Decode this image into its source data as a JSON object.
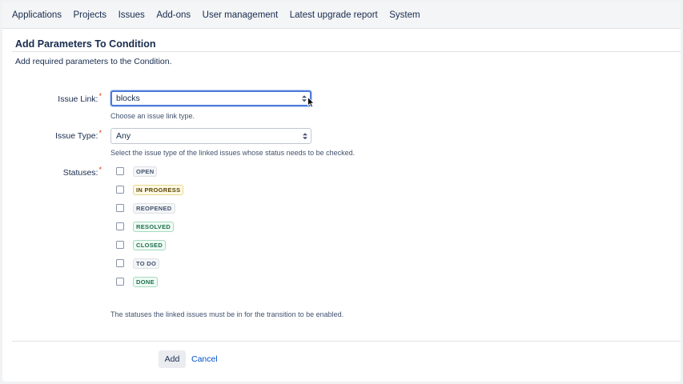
{
  "nav": {
    "items": [
      "Applications",
      "Projects",
      "Issues",
      "Add-ons",
      "User management",
      "Latest upgrade report",
      "System"
    ]
  },
  "section": {
    "title": "Add Parameters To Condition",
    "description": "Add required parameters to the Condition."
  },
  "form": {
    "issue_link": {
      "label": "Issue Link:",
      "value": "blocks",
      "help": "Choose an issue link type."
    },
    "issue_type": {
      "label": "Issue Type:",
      "value": "Any",
      "help": "Select the issue type of the linked issues whose status needs to be checked."
    },
    "statuses": {
      "label": "Statuses:",
      "items": [
        {
          "name": "OPEN",
          "checked": false,
          "color": "grey"
        },
        {
          "name": "IN PROGRESS",
          "checked": false,
          "color": "yellow"
        },
        {
          "name": "REOPENED",
          "checked": false,
          "color": "grey"
        },
        {
          "name": "RESOLVED",
          "checked": false,
          "color": "green"
        },
        {
          "name": "CLOSED",
          "checked": false,
          "color": "green"
        },
        {
          "name": "TO DO",
          "checked": false,
          "color": "grey"
        },
        {
          "name": "DONE",
          "checked": false,
          "color": "green"
        }
      ],
      "help": "The statuses the linked issues must be in for the transition to be enabled."
    },
    "required_marker": "*"
  },
  "buttons": {
    "add_label": "Add",
    "cancel_label": "Cancel"
  },
  "colors": {
    "link": "#0052cc",
    "focus": "#4c7bd9",
    "required": "#de350b"
  }
}
